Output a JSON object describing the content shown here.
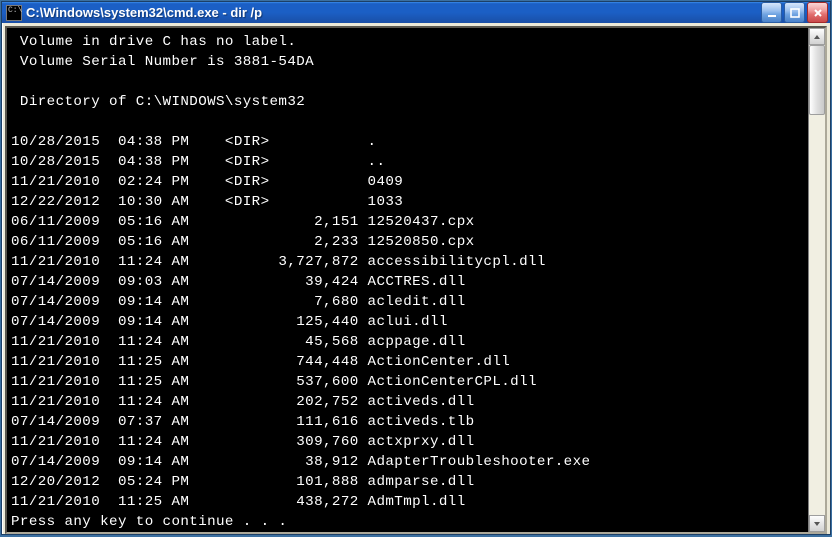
{
  "window": {
    "title": "C:\\Windows\\system32\\cmd.exe - dir   /p"
  },
  "output": {
    "volume_label_line": "Volume in drive C has no label.",
    "volume_serial_line": "Volume Serial Number is 3881-54DA",
    "directory_line": " Directory of C:\\WINDOWS\\system32",
    "press_key_line": "Press any key to continue . . ."
  },
  "entries": [
    {
      "date": "10/28/2015",
      "time": "04:38 PM",
      "dir": true,
      "size": "",
      "name": "."
    },
    {
      "date": "10/28/2015",
      "time": "04:38 PM",
      "dir": true,
      "size": "",
      "name": ".."
    },
    {
      "date": "11/21/2010",
      "time": "02:24 PM",
      "dir": true,
      "size": "",
      "name": "0409"
    },
    {
      "date": "12/22/2012",
      "time": "10:30 AM",
      "dir": true,
      "size": "",
      "name": "1033"
    },
    {
      "date": "06/11/2009",
      "time": "05:16 AM",
      "dir": false,
      "size": "2,151",
      "name": "12520437.cpx"
    },
    {
      "date": "06/11/2009",
      "time": "05:16 AM",
      "dir": false,
      "size": "2,233",
      "name": "12520850.cpx"
    },
    {
      "date": "11/21/2010",
      "time": "11:24 AM",
      "dir": false,
      "size": "3,727,872",
      "name": "accessibilitycpl.dll"
    },
    {
      "date": "07/14/2009",
      "time": "09:03 AM",
      "dir": false,
      "size": "39,424",
      "name": "ACCTRES.dll"
    },
    {
      "date": "07/14/2009",
      "time": "09:14 AM",
      "dir": false,
      "size": "7,680",
      "name": "acledit.dll"
    },
    {
      "date": "07/14/2009",
      "time": "09:14 AM",
      "dir": false,
      "size": "125,440",
      "name": "aclui.dll"
    },
    {
      "date": "11/21/2010",
      "time": "11:24 AM",
      "dir": false,
      "size": "45,568",
      "name": "acppage.dll"
    },
    {
      "date": "11/21/2010",
      "time": "11:25 AM",
      "dir": false,
      "size": "744,448",
      "name": "ActionCenter.dll"
    },
    {
      "date": "11/21/2010",
      "time": "11:25 AM",
      "dir": false,
      "size": "537,600",
      "name": "ActionCenterCPL.dll"
    },
    {
      "date": "11/21/2010",
      "time": "11:24 AM",
      "dir": false,
      "size": "202,752",
      "name": "activeds.dll"
    },
    {
      "date": "07/14/2009",
      "time": "07:37 AM",
      "dir": false,
      "size": "111,616",
      "name": "activeds.tlb"
    },
    {
      "date": "11/21/2010",
      "time": "11:24 AM",
      "dir": false,
      "size": "309,760",
      "name": "actxprxy.dll"
    },
    {
      "date": "07/14/2009",
      "time": "09:14 AM",
      "dir": false,
      "size": "38,912",
      "name": "AdapterTroubleshooter.exe"
    },
    {
      "date": "12/20/2012",
      "time": "05:24 PM",
      "dir": false,
      "size": "101,888",
      "name": "admparse.dll"
    },
    {
      "date": "11/21/2010",
      "time": "11:25 AM",
      "dir": false,
      "size": "438,272",
      "name": "AdmTmpl.dll"
    }
  ]
}
